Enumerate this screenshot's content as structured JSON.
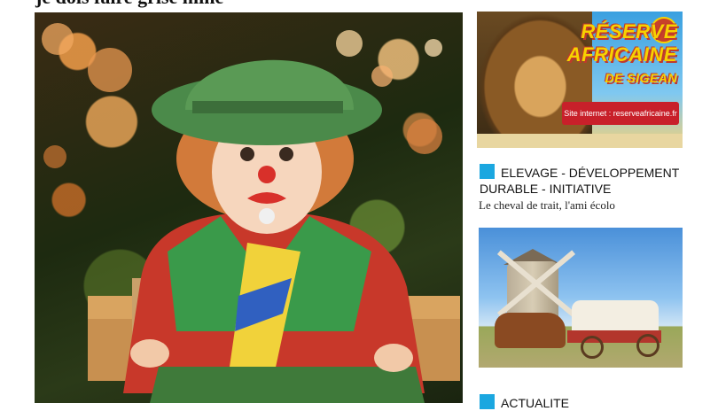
{
  "headline": "je dois faire grise mine",
  "ad": {
    "title_line1": "RÉSERVE",
    "title_line2": "AFRICAINE",
    "title_line3": "DE SIGEAN",
    "site": "Site internet : reserveafricaine.fr"
  },
  "articles": [
    {
      "category": "ELEVAGE - DÉVELOPPEMENT DURABLE - INITIATIVE",
      "subtitle": "Le cheval de trait, l'ami écolo"
    },
    {
      "category": "ACTUALITE"
    }
  ],
  "colors": {
    "accent_square": "#1ba7e0",
    "ad_red": "#c8202a",
    "ad_yellow": "#f7d200"
  }
}
